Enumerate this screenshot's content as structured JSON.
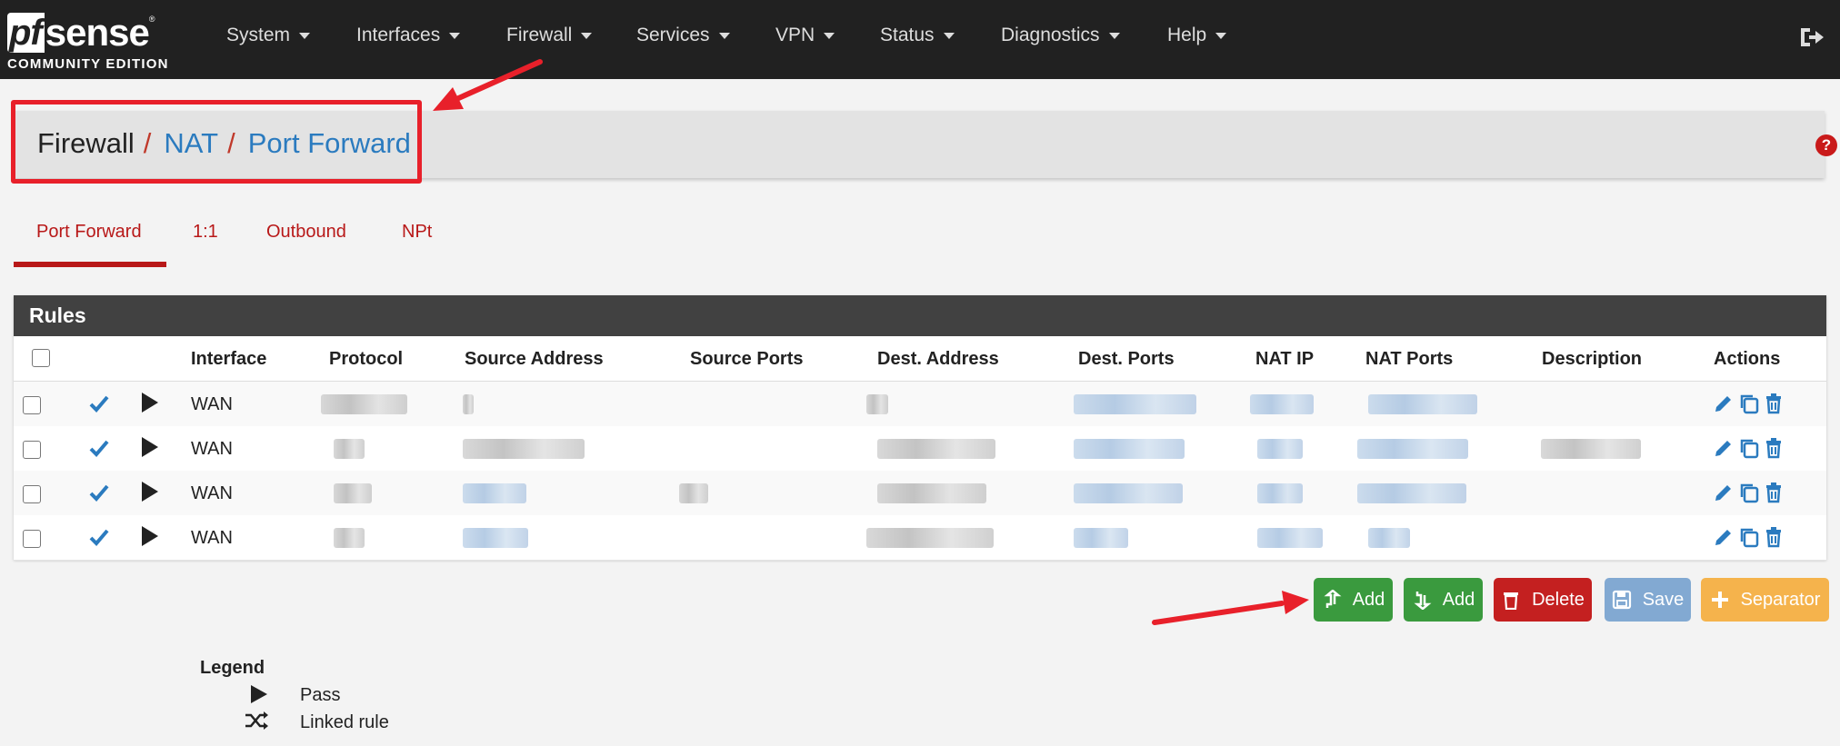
{
  "brand": {
    "pf": "pf",
    "sense": "sense",
    "edition": "COMMUNITY EDITION"
  },
  "nav": {
    "items": [
      {
        "label": "System"
      },
      {
        "label": "Interfaces"
      },
      {
        "label": "Firewall"
      },
      {
        "label": "Services"
      },
      {
        "label": "VPN"
      },
      {
        "label": "Status"
      },
      {
        "label": "Diagnostics"
      },
      {
        "label": "Help"
      }
    ]
  },
  "breadcrumb": {
    "items": [
      "Firewall",
      "NAT",
      "Port Forward"
    ],
    "separator": "/"
  },
  "help": {
    "label": "?"
  },
  "tabs": [
    {
      "label": "Port Forward",
      "active": true
    },
    {
      "label": "1:1",
      "active": false
    },
    {
      "label": "Outbound",
      "active": false
    },
    {
      "label": "NPt",
      "active": false
    }
  ],
  "rules": {
    "title": "Rules",
    "columns": [
      "Interface",
      "Protocol",
      "Source Address",
      "Source Ports",
      "Dest. Address",
      "Dest. Ports",
      "NAT IP",
      "NAT Ports",
      "Description",
      "Actions"
    ],
    "rows": [
      {
        "interface": "WAN"
      },
      {
        "interface": "WAN"
      },
      {
        "interface": "WAN"
      },
      {
        "interface": "WAN"
      }
    ]
  },
  "buttons": {
    "add_top": "Add",
    "add_bottom": "Add",
    "delete": "Delete",
    "save": "Save",
    "separator": "Separator"
  },
  "legend": {
    "title": "Legend",
    "items": [
      {
        "label": "Pass"
      },
      {
        "label": "Linked rule"
      }
    ]
  },
  "colors": {
    "navbar": "#212121",
    "link": "#2b7bbf",
    "tab_active": "#b81818",
    "annotation": "#e8202a",
    "add": "#3a9a3e",
    "delete": "#c42020",
    "save": "#82a9d2",
    "separator": "#f5b34c"
  }
}
